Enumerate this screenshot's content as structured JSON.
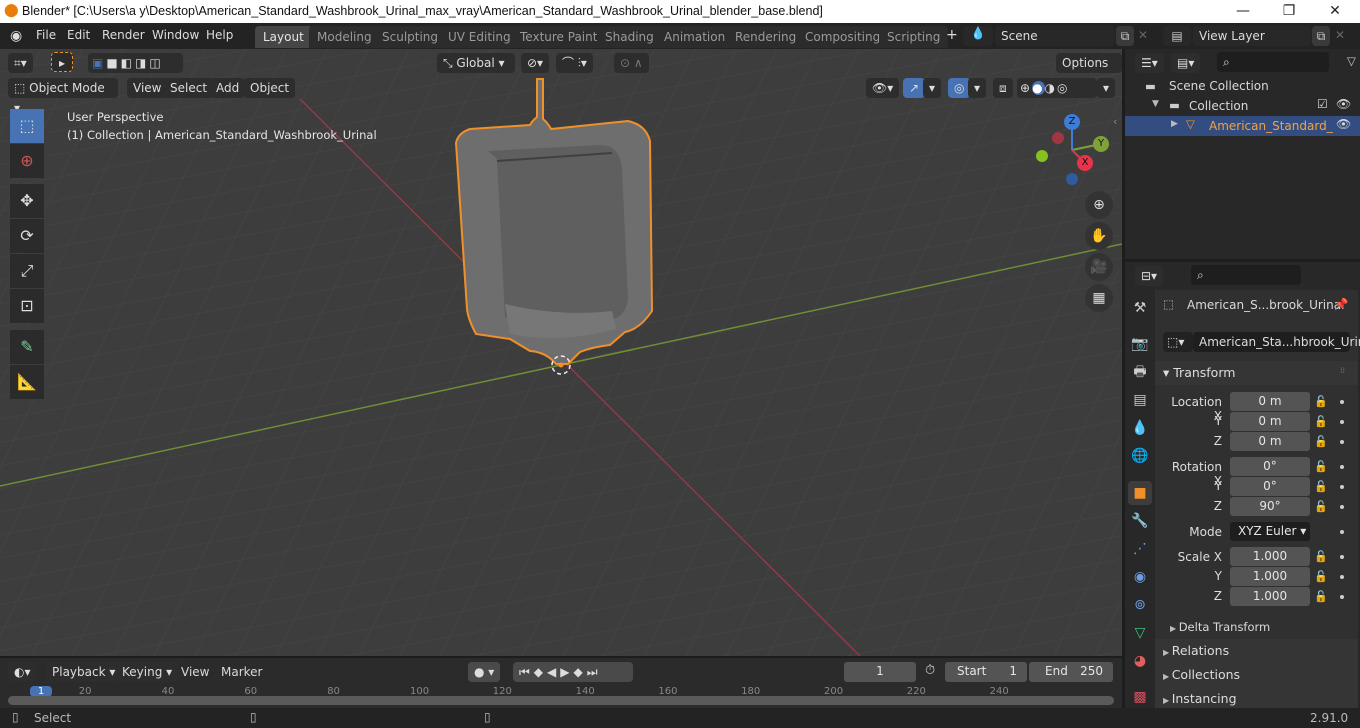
{
  "window": {
    "title": "Blender* [C:\\Users\\a y\\Desktop\\American_Standard_Washbrook_Urinal_max_vray\\American_Standard_Washbrook_Urinal_blender_base.blend]",
    "minimize": "—",
    "maximize": "❐",
    "close": "✕"
  },
  "menubar": {
    "items": [
      "File",
      "Edit",
      "Render",
      "Window",
      "Help"
    ]
  },
  "workspaces": [
    "Layout",
    "Modeling",
    "Sculpting",
    "UV Editing",
    "Texture Paint",
    "Shading",
    "Animation",
    "Rendering",
    "Compositing",
    "Scripting"
  ],
  "active_workspace": "Layout",
  "add_workspace": "+",
  "scene": {
    "value": "Scene"
  },
  "view_layer": {
    "value": "View Layer"
  },
  "viewport": {
    "transform_orientation": "Global",
    "options_label": "Options",
    "mode": "Object Mode",
    "menus": [
      "View",
      "Select",
      "Add",
      "Object"
    ],
    "perspective_label": "User Perspective",
    "collection_info": "(1) Collection | American_Standard_Washbrook_Urinal",
    "gizmo": {
      "x": "X",
      "y": "Y",
      "z": "Z"
    },
    "colors": {
      "x_axis": "#c3384a",
      "y_axis": "#7ea238",
      "selection": "#f0902a",
      "active_tool": "#4772b3"
    }
  },
  "outliner": {
    "scene_collection": "Scene Collection",
    "collection": "Collection",
    "object": "American_Standard_"
  },
  "properties": {
    "object_name": "American_S...brook_Urinal",
    "data_name": "American_Sta...hbrook_Urinal",
    "transform_title": "Transform",
    "location": {
      "label": "Location X",
      "x": "0 m",
      "y": "0 m",
      "z": "0 m"
    },
    "rotation": {
      "label": "Rotation X",
      "x": "0°",
      "y": "0°",
      "z": "90°"
    },
    "mode_label": "Mode",
    "mode_value": "XYZ Euler",
    "scale": {
      "label": "Scale X",
      "x": "1.000",
      "y": "1.000",
      "z": "1.000"
    },
    "axis_labels": {
      "y": "Y",
      "z": "Z"
    },
    "subsections": [
      "Delta Transform",
      "Relations",
      "Collections",
      "Instancing"
    ]
  },
  "timeline": {
    "menus": [
      "Playback",
      "Keying",
      "View",
      "Marker"
    ],
    "current_frame": "1",
    "start_label": "Start",
    "start": "1",
    "end_label": "End",
    "end": "250",
    "ruler": [
      "1",
      "20",
      "40",
      "60",
      "80",
      "100",
      "120",
      "140",
      "160",
      "180",
      "200",
      "220",
      "240"
    ]
  },
  "statusbar": {
    "select_label": "Select",
    "version": "2.91.0"
  }
}
